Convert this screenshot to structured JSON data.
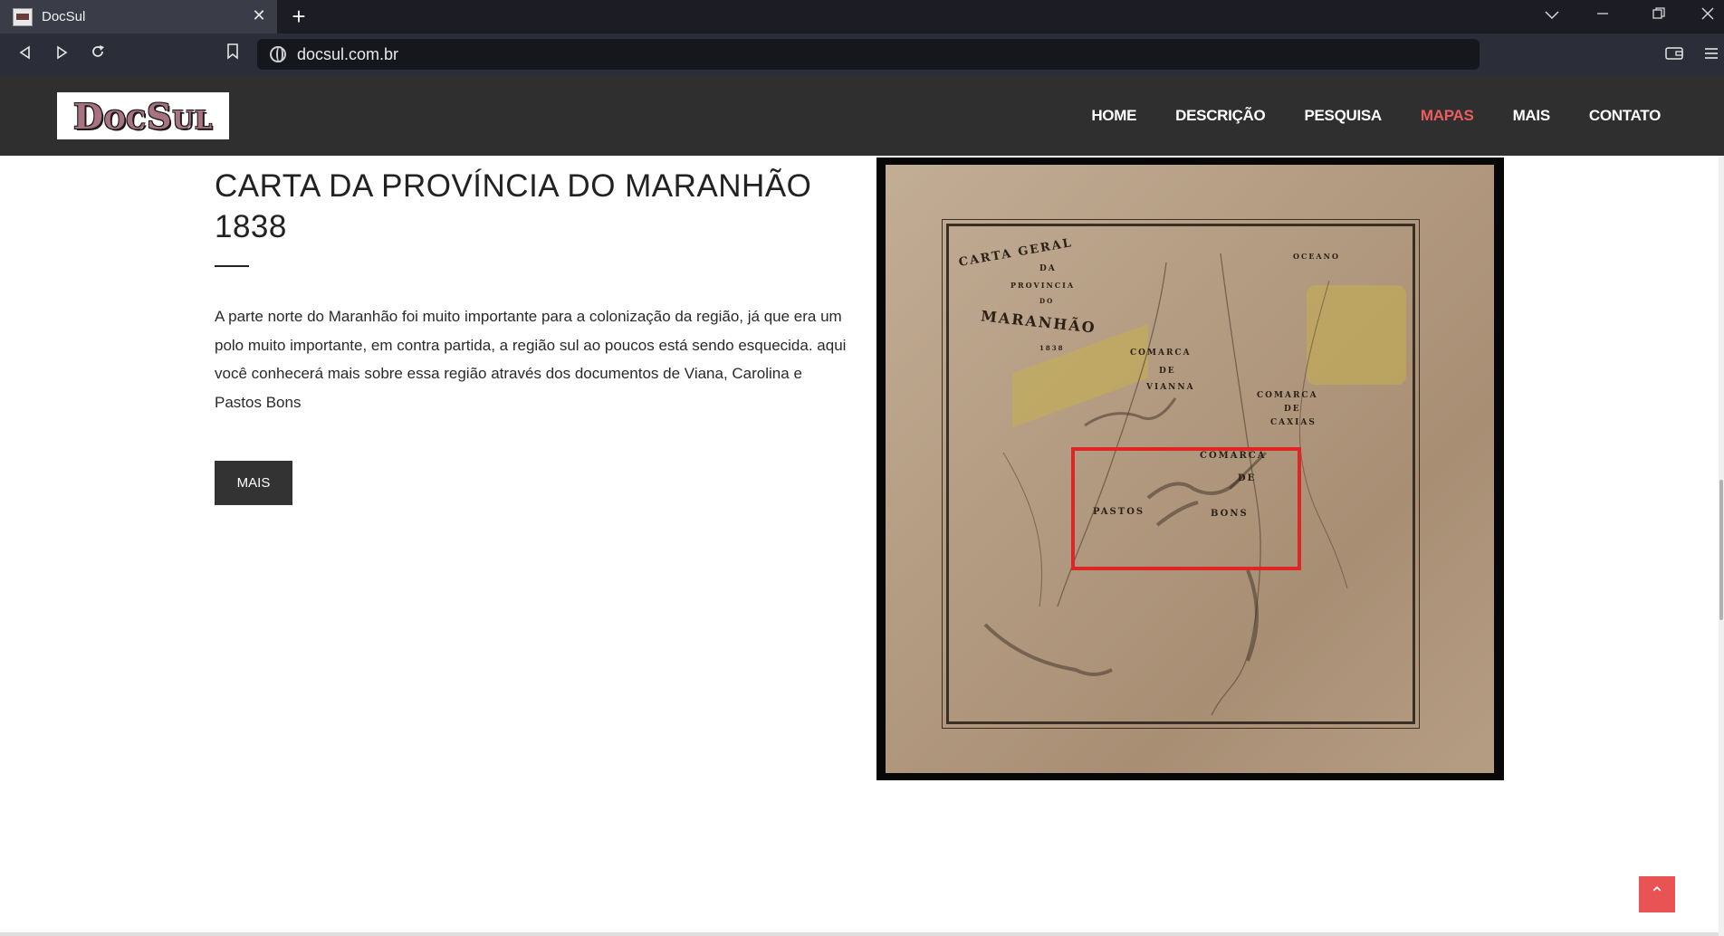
{
  "browser": {
    "tab_title": "DocSul",
    "close_glyph": "✕",
    "newtab_glyph": "+",
    "url": "docsul.com.br",
    "icons": [
      "back-icon",
      "forward-icon",
      "reload-icon",
      "bookmark-icon",
      "globe-icon",
      "wallet-icon",
      "menu-icon",
      "tab-list-icon",
      "minimize-icon",
      "restore-icon",
      "close-icon"
    ]
  },
  "site": {
    "logo_text": "DocSul",
    "nav": {
      "home": "HOME",
      "descricao": "DESCRIÇÃO",
      "pesquisa": "PESQUISA",
      "mapas": "MAPAS",
      "mais": "MAIS",
      "contato": "CONTATO"
    },
    "active_nav": "MAPAS",
    "accent_color": "#ec5d5d"
  },
  "content": {
    "title": "CARTA DA PROVÍNCIA DO MARANHÃO 1838",
    "description": "A parte norte do Maranhão foi muito importante para a colonização da região, já que era um polo muito importante, em contra partida, a região sul ao poucos está sendo esquecida. aqui você conhecerá mais sobre essa região através dos documentos de Viana, Carolina e Pastos Bons",
    "button_label": "MAIS"
  },
  "map": {
    "labels": {
      "carta": "CARTA GERAL",
      "da": "DA",
      "provincia": "PROVINCIA",
      "do": "DO",
      "maranhao": "MARANHÃO",
      "year": "1838",
      "oceano": "OCEANO",
      "comarca1": "COMARCA",
      "de1": "DE",
      "vianna": "VIANNA",
      "comarca2": "COMARCA",
      "de2": "DE",
      "caxias": "CAXIAS",
      "comarca3": "COMARCA",
      "de3": "DE",
      "pastos": "PASTOS",
      "bons": "BONS"
    }
  },
  "ui": {
    "scroll_top_glyph": "⌃"
  }
}
